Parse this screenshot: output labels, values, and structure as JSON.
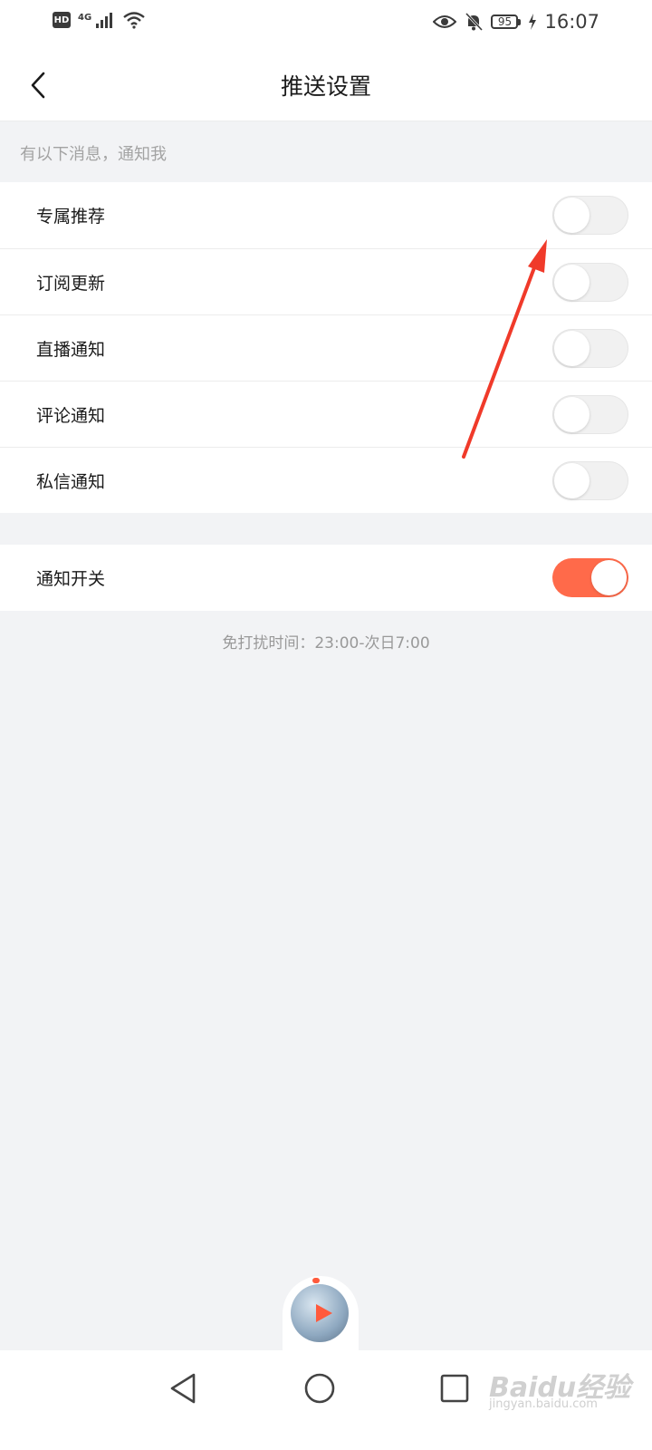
{
  "status_bar": {
    "hd": "HD",
    "network": "4G",
    "battery": "95",
    "time": "16:07"
  },
  "header": {
    "title": "推送设置"
  },
  "notify_section": {
    "label": "有以下消息，通知我",
    "items": [
      {
        "label": "专属推荐",
        "on": false
      },
      {
        "label": "订阅更新",
        "on": false
      },
      {
        "label": "直播通知",
        "on": false
      },
      {
        "label": "评论通知",
        "on": false
      },
      {
        "label": "私信通知",
        "on": false
      }
    ]
  },
  "master": {
    "label": "通知开关",
    "on": true
  },
  "dnd": "免打扰时间：23:00-次日7:00",
  "watermark": {
    "brand": "Baidu经验",
    "url": "jingyan.baidu.com"
  },
  "colors": {
    "accent": "#ff6a4a",
    "annotation_arrow": "#f03a2a",
    "background": "#f2f3f5"
  },
  "icons": [
    "hd-icon",
    "signal-icon",
    "wifi-icon",
    "eye-icon",
    "bell-muted-icon",
    "battery-icon",
    "charging-icon",
    "chevron-left-icon",
    "play-icon",
    "nav-back-icon",
    "nav-home-icon",
    "nav-recent-icon"
  ]
}
